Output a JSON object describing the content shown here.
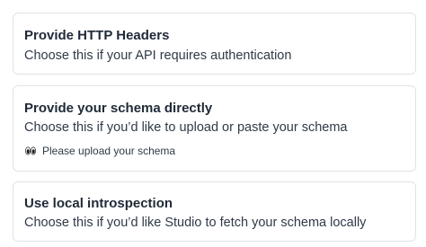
{
  "options": [
    {
      "title": "Provide HTTP Headers",
      "description": "Choose this if your API requires authentication"
    },
    {
      "title": "Provide your schema directly",
      "description": "Choose this if you’d like to upload or paste your schema",
      "hint": {
        "icon": "eyes-icon",
        "text": "Please upload your schema"
      }
    },
    {
      "title": "Use local introspection",
      "description": "Choose this if you’d like Studio to fetch your schema locally"
    }
  ],
  "colors": {
    "border": "#dfe3e8",
    "title": "#1f2a37",
    "text": "#2f3a48"
  }
}
